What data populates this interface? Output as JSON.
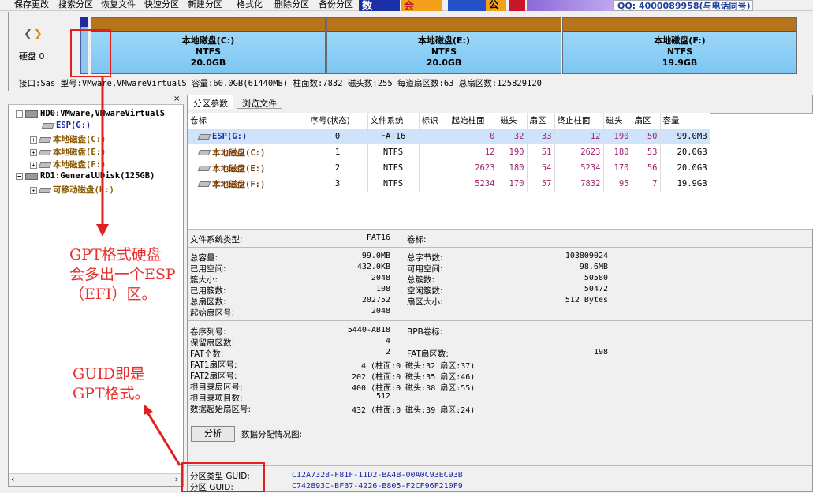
{
  "toolbar": {
    "items": [
      "保存更改",
      "搜索分区",
      "恢复文件",
      "快速分区",
      "新建分区",
      "格式化",
      "删除分区",
      "备份分区"
    ],
    "banner_text_1": "数",
    "banner_text_2": "会",
    "banner_text_3": "公",
    "qq": "QQ: 4000089958(与电话同号)"
  },
  "disk_bar": {
    "disk_label": "硬盘 0",
    "partitions": [
      {
        "name": "本地磁盘(C:)",
        "fs": "NTFS",
        "size": "20.0GB"
      },
      {
        "name": "本地磁盘(E:)",
        "fs": "NTFS",
        "size": "20.0GB"
      },
      {
        "name": "本地磁盘(F:)",
        "fs": "NTFS",
        "size": "19.9GB"
      }
    ],
    "info_line": "接口:Sas  型号:VMware,VMwareVirtualS  容量:60.0GB(61440MB)  柱面数:7832  磁头数:255  每道扇区数:63  总扇区数:125829120"
  },
  "tree": {
    "nodes": [
      {
        "text": "HD0:VMware,VMwareVirtualS"
      },
      {
        "text": "ESP(G:)"
      },
      {
        "text": "本地磁盘(C:)"
      },
      {
        "text": "本地磁盘(E:)"
      },
      {
        "text": "本地磁盘(F:)"
      },
      {
        "text": "RD1:GeneralUDisk(125GB)"
      },
      {
        "text": "可移动磁盘(H:)"
      }
    ]
  },
  "tabs": [
    "分区参数",
    "浏览文件"
  ],
  "partition_table": {
    "headers": [
      "卷标",
      "序号(状态)",
      "文件系统",
      "标识",
      "起始柱面",
      "磁头",
      "扇区",
      "终止柱面",
      "磁头",
      "扇区",
      "容量"
    ],
    "rows": [
      [
        "ESP(G:)",
        "0",
        "FAT16",
        "",
        "0",
        "32",
        "33",
        "12",
        "190",
        "50",
        "99.0MB"
      ],
      [
        "本地磁盘(C:)",
        "1",
        "NTFS",
        "",
        "12",
        "190",
        "51",
        "2623",
        "180",
        "53",
        "20.0GB"
      ],
      [
        "本地磁盘(E:)",
        "2",
        "NTFS",
        "",
        "2623",
        "180",
        "54",
        "5234",
        "170",
        "56",
        "20.0GB"
      ],
      [
        "本地磁盘(F:)",
        "3",
        "NTFS",
        "",
        "5234",
        "170",
        "57",
        "7832",
        "95",
        "7",
        "19.9GB"
      ]
    ]
  },
  "details": {
    "fs_type_label": "文件系统类型:",
    "fs_type": "FAT16",
    "vol_label_label": "卷标:",
    "total_cap_label": "总容量:",
    "total_cap": "99.0MB",
    "total_bytes_label": "总字节数:",
    "total_bytes": "103809024",
    "used_label": "已用空间:",
    "used": "432.0KB",
    "free_label": "可用空间:",
    "free": "98.6MB",
    "cluster_size_label": "簇大小:",
    "cluster_size": "2048",
    "total_clusters_label": "总簇数:",
    "total_clusters": "50580",
    "used_clusters_label": "已用簇数:",
    "used_clusters": "108",
    "free_clusters_label": "空闲簇数:",
    "free_clusters": "50472",
    "total_sectors_label": "总扇区数:",
    "total_sectors": "202752",
    "sector_size_label": "扇区大小:",
    "sector_size": "512 Bytes",
    "start_sector_label": "起始扇区号:",
    "start_sector": "2048",
    "serial_label": "卷序列号:",
    "serial": "5440-AB18",
    "bpb_label": "BPB卷标:",
    "reserved_label": "保留扇区数:",
    "reserved": "4",
    "fat_count_label": "FAT个数:",
    "fat_count": "2",
    "fat_sectors_label": "FAT扇区数:",
    "fat_sectors": "198",
    "fat1_label": "FAT1扇区号:",
    "fat1": "4 (柱面:0 磁头:32 扇区:37)",
    "fat2_label": "FAT2扇区号:",
    "fat2": "202 (柱面:0 磁头:35 扇区:46)",
    "root_sector_label": "根目录扇区号:",
    "root_sector": "400 (柱面:0 磁头:38 扇区:55)",
    "root_entries_label": "根目录项目数:",
    "root_entries": "512",
    "data_start_label": "数据起始扇区号:",
    "data_start": "432 (柱面:0 磁头:39 扇区:24)",
    "analyze_button": "分析",
    "alloc_label": "数据分配情况图:",
    "type_guid_label": "分区类型 GUID:",
    "type_guid": "C12A7328-F81F-11D2-BA4B-00A0C93EC93B",
    "part_guid_label": "分区 GUID:",
    "part_guid": "C742893C-BFB7-4226-B805-F2CF96F210F9"
  },
  "annotations": {
    "note1_line1": "GPT格式硬盘",
    "note1_line2": "会多出一个ESP",
    "note1_line3": "（EFI）区。",
    "note2_line1": "GUID即是",
    "note2_line2": "GPT格式。"
  },
  "colors": {
    "accent": "#e02020",
    "partition_fill": "#8fcdf4",
    "partition_cap": "#b8741a",
    "selection": "#cfe3fb"
  }
}
